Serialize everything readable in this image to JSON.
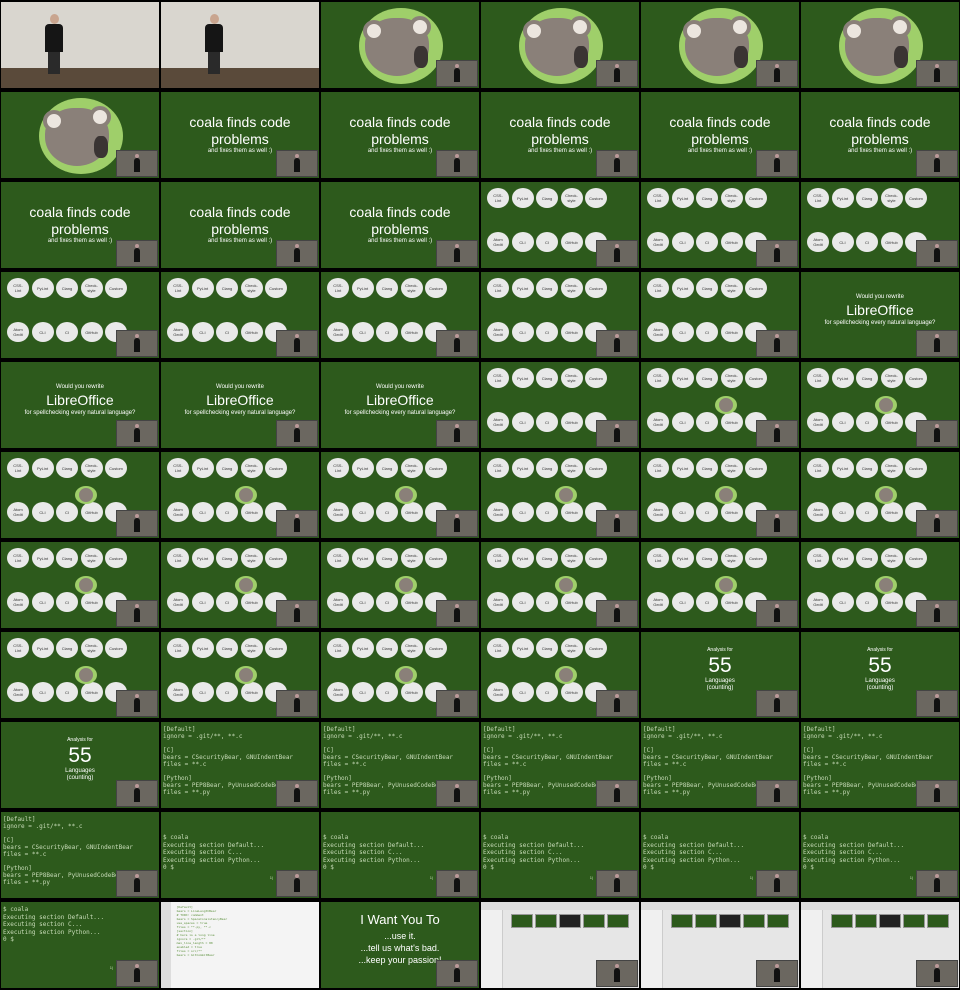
{
  "koala_title": "coala finds code problems",
  "koala_subtitle": "and fixes them as well :)",
  "bubbles_row1": [
    "CSS-\nLint",
    "PyLint",
    "Clang",
    "Check-\nstyle",
    "Custom"
  ],
  "bubbles_row2": [
    "Atom\nGedit",
    "CLI",
    "CI",
    "GitHub",
    ""
  ],
  "question": {
    "line1": "Would you rewrite",
    "line2": "LibreOffice",
    "line3": "for spellchecking every natural language?"
  },
  "analysis": {
    "label": "Analysis for",
    "number": "55",
    "line1": "Languages",
    "line2": "(counting)"
  },
  "config": "[Default]\nignore = .git/**, **.c\n\n[C]\nbears = CSecurityBear, GNUIndentBear\nfiles = **.c\n\n[Python]\nbears = PEP8Bear, PyUnusedCodeBear\nfiles = **.py",
  "terminal": "$ coala\nExecuting section Default...\nExecuting section C...\nExecuting section Python...\n0 $",
  "terminal_pos": "1|",
  "editor_lines": "  [Default]\n  bears = LineLengthBear\n  # TODO: comment\n  bears = SpaceConsistencyBear\n  use_spaces = true\n  files = **.py, **.c\n  [section]\n  # here is a long line\n  ignore = .git/**\n  max_line_length = 80\n  enabled = true\n  files = src/**\n  bears = GitCommitBear",
  "want": {
    "title": "I Want You To",
    "line1": "...use it.",
    "line2": "...tell us what's bad.",
    "line3": "...keep your passion!"
  },
  "tiles": [
    "photo",
    "photo",
    "logo",
    "logo",
    "logo",
    "logo",
    "logo",
    "title",
    "title",
    "title",
    "title",
    "title",
    "title",
    "title",
    "title",
    "bubbles",
    "bubbles",
    "bubbles",
    "bubbles",
    "bubbles",
    "bubbles",
    "bubbles",
    "bubbles",
    "question",
    "question",
    "question",
    "question",
    "bubbles",
    "bubbles-k",
    "bubbles-k",
    "bubbles-k",
    "bubbles-k",
    "bubbles-k",
    "bubbles-k",
    "bubbles-k",
    "bubbles-k",
    "bubbles-k",
    "bubbles-k",
    "bubbles-k",
    "bubbles-k",
    "bubbles-k",
    "bubbles-k",
    "bubbles-k",
    "bubbles-k",
    "bubbles-k",
    "bubbles-k",
    "analysis",
    "analysis",
    "analysis",
    "config",
    "config",
    "config",
    "config",
    "config",
    "config-full",
    "term",
    "term",
    "term",
    "term",
    "term",
    "term-first",
    "editor",
    "want",
    "files",
    "files",
    "files"
  ]
}
